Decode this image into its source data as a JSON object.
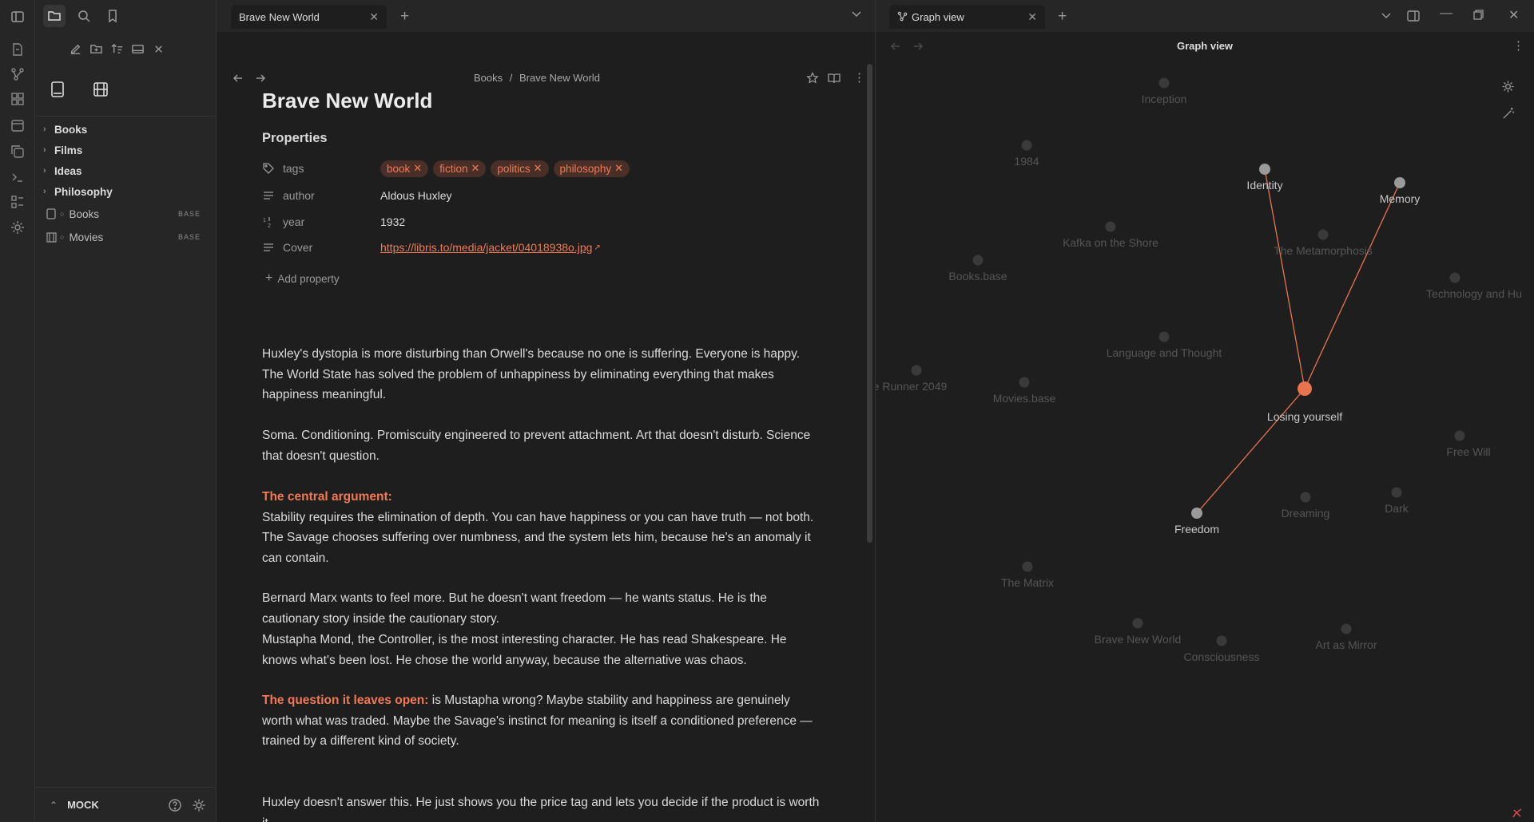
{
  "ribbon": {
    "icons": [
      "sidebar-toggle-icon",
      "file-icon",
      "graph-icon",
      "grid-icon",
      "calendar-icon",
      "copy-icon",
      "terminal-icon",
      "list-icon",
      "settings-gear-icon"
    ]
  },
  "sidebar": {
    "vault_name": "MOCK",
    "tree": [
      {
        "label": "Books",
        "type": "folder"
      },
      {
        "label": "Films",
        "type": "folder"
      },
      {
        "label": "Ideas",
        "type": "folder"
      },
      {
        "label": "Philosophy",
        "type": "folder"
      },
      {
        "label": "Books",
        "type": "base",
        "badge": "BASE"
      },
      {
        "label": "Movies",
        "type": "base",
        "badge": "BASE"
      }
    ]
  },
  "left_pane": {
    "tab_title": "Brave New World",
    "breadcrumb": {
      "folder": "Books",
      "separator": "/",
      "file": "Brave New World"
    },
    "note": {
      "title": "Brave New World",
      "properties_label": "Properties",
      "properties": {
        "tags_key": "tags",
        "tags": [
          "book",
          "fiction",
          "politics",
          "philosophy"
        ],
        "author_key": "author",
        "author": "Aldous Huxley",
        "year_key": "year",
        "year": "1932",
        "cover_key": "Cover",
        "cover": "https://libris.to/media/jacket/04018938o.jpg"
      },
      "add_property": "Add property",
      "paragraphs": {
        "p1": "Huxley's dystopia is more disturbing than Orwell's because no one is suffering. Everyone is happy. The World State has solved the problem of unhappiness by eliminating everything that makes happiness meaningful.",
        "p2": "Soma. Conditioning. Promiscuity engineered to prevent attachment. Art that doesn't disturb. Science that doesn't question.",
        "h3": "The central argument:",
        "p3": "Stability requires the elimination of depth. You can have happiness or you can have truth — not both. The Savage chooses suffering over numbness, and the system lets him, because he's an anomaly it can contain.",
        "p4": "Bernard Marx wants to feel more. But he doesn't want freedom — he wants status. He is the cautionary story inside the cautionary story.",
        "p5": "Mustapha Mond, the Controller, is the most interesting character. He has read Shakespeare. He knows what's been lost. He chose the world anyway, because the alternative was chaos.",
        "h6": "The question it leaves open:",
        "p6": " is Mustapha wrong? Maybe stability and happiness are genuinely worth what was traded. Maybe the Savage's instinct for meaning is itself a conditioned preference — trained by a different kind of society.",
        "p7": "Huxley doesn't answer this. He just shows you the price tag and lets you decide if the product is worth it."
      }
    }
  },
  "right_pane": {
    "tab_title": "Graph view",
    "header": "Graph view",
    "nodes": [
      {
        "label": "Inception",
        "active": false
      },
      {
        "label": "1984",
        "active": false
      },
      {
        "label": "Identity",
        "active": true
      },
      {
        "label": "Memory",
        "active": true
      },
      {
        "label": "Kafka on the Shore",
        "active": false
      },
      {
        "label": "Books.base",
        "active": false
      },
      {
        "label": "The Metamorphosis",
        "active": false
      },
      {
        "label": "Technology and Hu",
        "active": false
      },
      {
        "label": "Language and Thought",
        "active": false
      },
      {
        "label": "Losing yourself",
        "active": true
      },
      {
        "label": "le Runner 2049",
        "active": false
      },
      {
        "label": "Movies.base",
        "active": false
      },
      {
        "label": "Free Will",
        "active": false
      },
      {
        "label": "Freedom",
        "active": true
      },
      {
        "label": "Dreaming",
        "active": false
      },
      {
        "label": "Dark",
        "active": false
      },
      {
        "label": "The Matrix",
        "active": false
      },
      {
        "label": "Brave New World",
        "active": false
      },
      {
        "label": "Consciousness",
        "active": false
      },
      {
        "label": "Art as Mirror",
        "active": false
      }
    ],
    "links": [
      [
        "Losing yourself",
        "Identity"
      ],
      [
        "Losing yourself",
        "Memory"
      ],
      [
        "Losing yourself",
        "Freedom"
      ]
    ],
    "colors": {
      "accent": "#e8734f",
      "node": "#9a9a9a",
      "dim_node": "#3a3a3a"
    }
  }
}
